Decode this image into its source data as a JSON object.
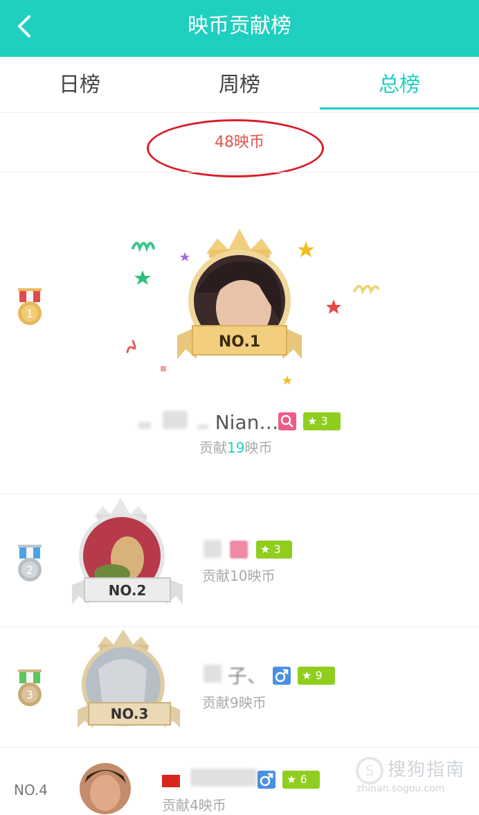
{
  "header": {
    "title": "映币贡献榜",
    "back_icon": "chevron-left-icon"
  },
  "tabs": [
    {
      "label": "日榜",
      "active": false
    },
    {
      "label": "周榜",
      "active": false
    },
    {
      "label": "总榜",
      "active": true
    }
  ],
  "total_coins": "48映币",
  "colors": {
    "accent": "#1fcfbf",
    "gold": "#e9c77a",
    "female": "#ee5b87",
    "male": "#4a90e2",
    "level": "#8fce1f"
  },
  "ranking": [
    {
      "rank_label": "NO.1",
      "medal_number": "1",
      "name_suffix": "Nian…",
      "gender": "female",
      "gender_icon": "female-icon",
      "level": "3",
      "contribution_prefix": "贡献",
      "contribution_value": "19",
      "contribution_suffix": "映币"
    },
    {
      "rank_label": "NO.2",
      "medal_number": "2",
      "gender": "female",
      "gender_icon": "female-icon",
      "level": "3",
      "contribution": "贡献10映币"
    },
    {
      "rank_label": "NO.3",
      "medal_number": "3",
      "name_suffix": "子、",
      "gender": "male",
      "gender_icon": "male-icon",
      "level": "9",
      "contribution": "贡献9映币"
    },
    {
      "rank_label": "NO.4",
      "gender": "male",
      "gender_icon": "male-icon",
      "level": "6",
      "contribution": "贡献4映币"
    }
  ],
  "watermark": {
    "text": "搜狗指南",
    "url": "zhinan.sogou.com"
  }
}
